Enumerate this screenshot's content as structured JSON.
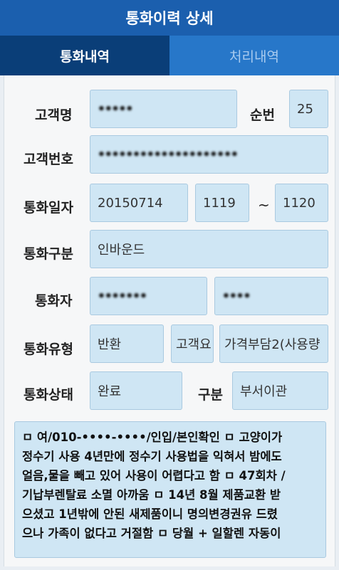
{
  "title": "통화이력 상세",
  "tabs": [
    {
      "label": "통화내역",
      "active": true
    },
    {
      "label": "처리내역",
      "active": false
    }
  ],
  "form": {
    "customer_name_label": "고객명",
    "customer_name_value": "•••••",
    "seq_label": "순번",
    "seq_value": "25",
    "customer_no_label": "고객번호",
    "customer_no_value": "••••••••••••••••••••",
    "call_date_label": "통화일자",
    "call_date_value": "20150714",
    "call_start_time": "1119",
    "range_separator": "~",
    "call_end_time": "1120",
    "call_type_label": "통화구분",
    "call_type_value": "인바운드",
    "caller_label": "통화자",
    "caller_value_1": "•••••••",
    "caller_value_2": "••••",
    "call_category_label": "통화유형",
    "category_1": "반환",
    "category_2": "고객요",
    "category_3": "가격부담2(사용량",
    "call_status_label": "통화상태",
    "status_value": "완료",
    "division_label": "구분",
    "division_value": "부서이관"
  },
  "memo": {
    "lines": [
      "ㅁ 여/010-••••-••••/인입/본인확인 ㅁ 고양이가",
      "정수기 사용 4년만에 정수기 사용법을 익혀서 밤에도",
      "얼음,물을 빼고 있어 사용이 어렵다고 함 ㅁ 47회차 /",
      "기납부렌탈료 소멸 아까움 ㅁ 14년 8월 제품교환 받",
      "으셨고 1년밖에 안된 새제품이니 명의변경권유 드렸",
      "으나 가족이 없다고 거절함 ㅁ 당월 + 일할렌 자동이"
    ]
  },
  "colors": {
    "titlebar": "#1b5fae",
    "tab_active": "#0a3e78",
    "tab_inactive": "#2777c9",
    "field_bg": "#cfe6f4"
  }
}
